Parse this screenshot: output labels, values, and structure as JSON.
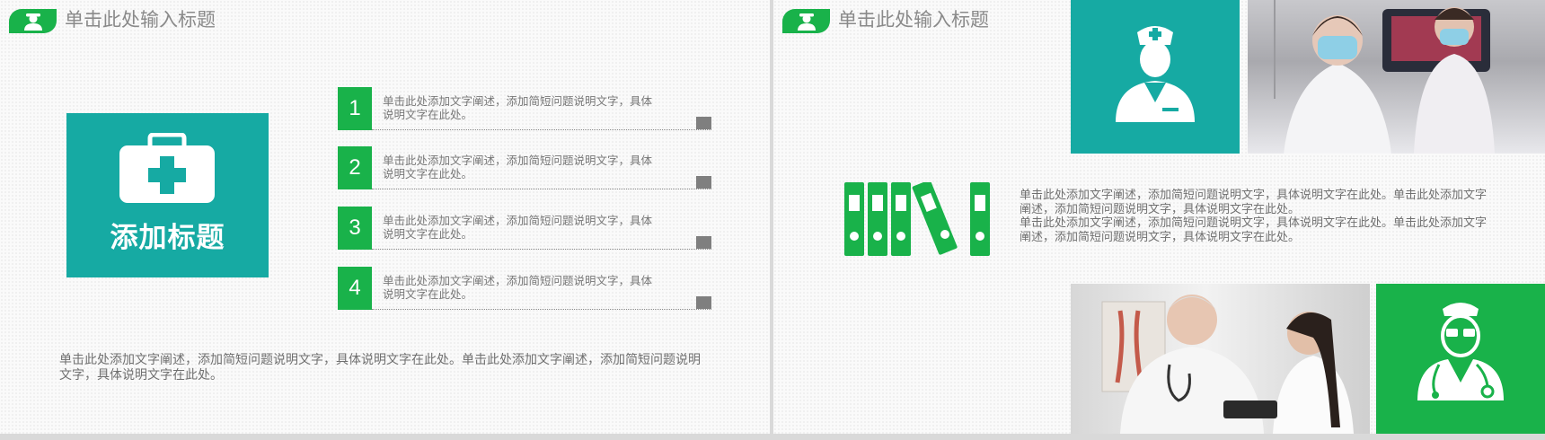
{
  "slides": [
    {
      "title": "单击此处输入标题",
      "feature_box": {
        "title": "添加标题",
        "icon": "first-aid-kit-icon"
      },
      "items": [
        {
          "number": "1",
          "text": "单击此处添加文字阐述，添加简短问题说明文字，具体说明文字在此处。"
        },
        {
          "number": "2",
          "text": "单击此处添加文字阐述，添加简短问题说明文字，具体说明文字在此处。"
        },
        {
          "number": "3",
          "text": "单击此处添加文字阐述，添加简短问题说明文字，具体说明文字在此处。"
        },
        {
          "number": "4",
          "text": "单击此处添加文字阐述，添加简短问题说明文字，具体说明文字在此处。"
        }
      ],
      "bottom_text": "单击此处添加文字阐述，添加简短问题说明文字，具体说明文字在此处。单击此处添加文字阐述，添加简短问题说明文字，具体说明文字在此处。"
    },
    {
      "title": "单击此处输入标题",
      "paragraph_lines": [
        "单击此处添加文字阐述，添加简短问题说明文字，具体说明文字在此处。单击此处添加文字阐述，添加简短问题说明文字，具体说明文字在此处。",
        "单击此处添加文字阐述，添加简短问题说明文字，具体说明文字在此处。单击此处添加文字阐述，添加简短问题说明文字，具体说明文字在此处。"
      ],
      "icons": [
        "nurse-icon",
        "binders-icon",
        "doctor-icon"
      ],
      "photos": [
        "nurses-photo",
        "doctor-patient-photo"
      ]
    }
  ],
  "colors": {
    "green": "#19b24a",
    "teal": "#16aaa3",
    "text_gray": "#777777",
    "title_gray": "#8a8a8a"
  }
}
